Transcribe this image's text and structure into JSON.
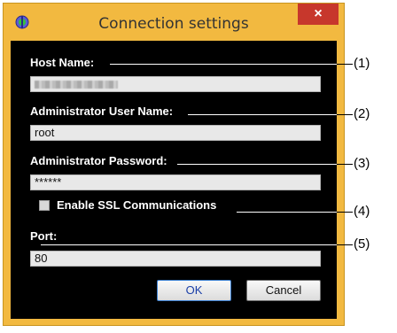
{
  "window": {
    "title": "Connection settings",
    "close_label": "×"
  },
  "form": {
    "host_name_label": "Host Name:",
    "admin_user_label": "Administrator User Name:",
    "admin_user_value": "root",
    "admin_password_label": "Administrator Password:",
    "admin_password_value": "******",
    "ssl_label": "Enable SSL Communications",
    "ssl_checked": false,
    "port_label": "Port:",
    "port_value": "80"
  },
  "buttons": {
    "ok_label": "OK",
    "cancel_label": "Cancel"
  },
  "callouts": [
    "(1)",
    "(2)",
    "(3)",
    "(4)",
    "(5)"
  ],
  "icons": {
    "app": "network-globe-icon",
    "close": "close-icon"
  },
  "colors": {
    "frame": "#f2b940",
    "close_button": "#c7372c",
    "client_background": "#000000"
  }
}
